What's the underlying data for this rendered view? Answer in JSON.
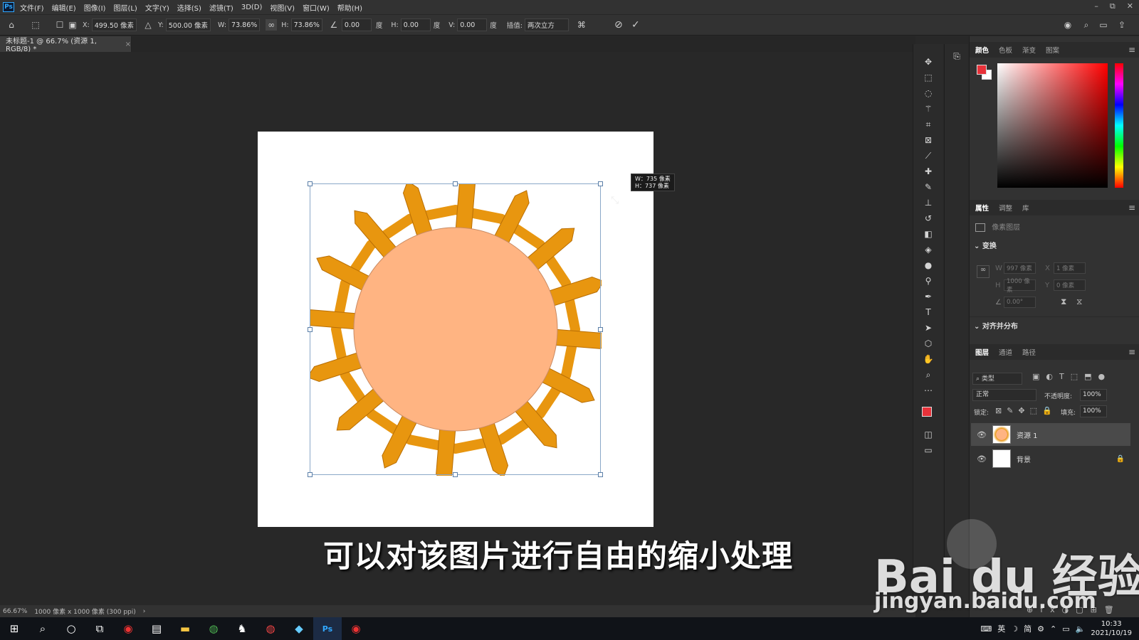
{
  "app": {
    "logo": "Ps",
    "window_controls": [
      "–",
      "⧉",
      "✕"
    ]
  },
  "menu": [
    "文件(F)",
    "编辑(E)",
    "图像(I)",
    "图层(L)",
    "文字(Y)",
    "选择(S)",
    "滤镜(T)",
    "3D(D)",
    "视图(V)",
    "窗口(W)",
    "帮助(H)"
  ],
  "options": {
    "x_label": "X:",
    "x_value": "499.50 像素",
    "y_label": "Y:",
    "y_value": "500.00 像素",
    "w_label": "W:",
    "w_value": "73.86%",
    "h_label": "H:",
    "h_value": "73.86%",
    "angle_value": "0.00",
    "deg": "度",
    "hskew_label": "H:",
    "hskew_value": "0.00",
    "vskew_label": "V:",
    "vskew_value": "0.00",
    "interp_label": "插值:",
    "interp_value": "两次立方"
  },
  "document": {
    "tab_title": "未标题-1 @ 66.7% (资源 1, RGB/8) *",
    "close": "×",
    "size_badge_w": "W：735 像素",
    "size_badge_h": "H：737 像素"
  },
  "status": {
    "zoom": "66.67%",
    "doc_info": "1000 像素 x 1000 像素 (300 ppi)",
    "arrow": "›"
  },
  "subtitle": "可以对该图片进行自由的缩小处理",
  "watermark": {
    "brand": "Bai du 经验",
    "url": "jingyan.baidu.com"
  },
  "panels": {
    "color_tabs": [
      "颜色",
      "色板",
      "渐变",
      "图案"
    ],
    "props_tabs": [
      "属性",
      "调整",
      "库"
    ],
    "pixel_layer": "像素图层",
    "transform": "变换",
    "w_val": "997 像素",
    "x_val": "1 像素",
    "h_val": "1000 像素",
    "y_val": "0 像素",
    "angle_val": "0.00°",
    "align": "对齐并分布",
    "layer_tabs": [
      "图层",
      "通道",
      "路径"
    ],
    "filter_kind": "类型",
    "blend_mode": "正常",
    "opacity_label": "不透明度:",
    "opacity_value": "100%",
    "lock_label": "锁定:",
    "fill_label": "填充:",
    "fill_value": "100%",
    "layers": [
      {
        "name": "资源 1"
      },
      {
        "name": "背景"
      }
    ]
  },
  "colors": {
    "foreground": "#e8323a",
    "background": "#ffffff",
    "sun_center": "#ffb482",
    "rays": "#e8960f"
  },
  "taskbar": {
    "ime": "英",
    "ime2": "简",
    "time": "10:33",
    "date": "2021/10/19"
  }
}
